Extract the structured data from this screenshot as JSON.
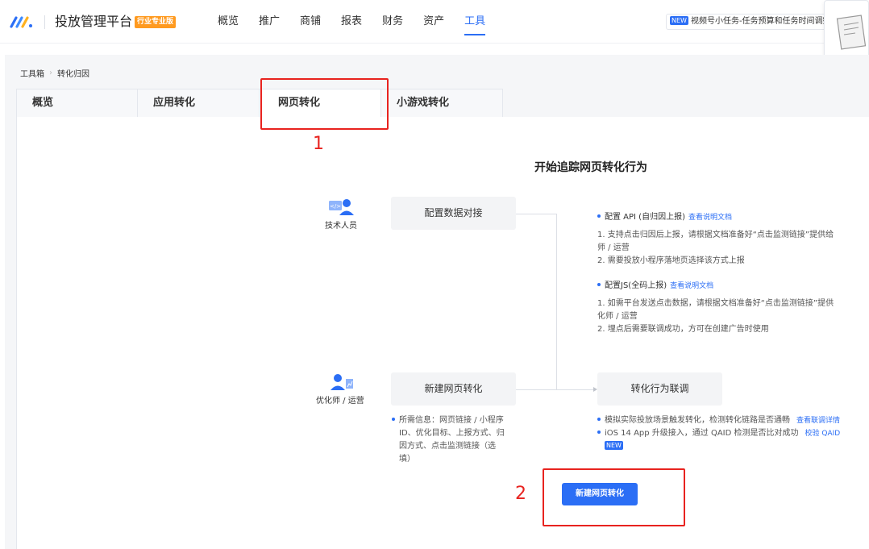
{
  "header": {
    "app_title": "投放管理平台",
    "edition_badge": "行业专业版",
    "nav": [
      "概览",
      "推广",
      "商铺",
      "报表",
      "财务",
      "资产",
      "工具"
    ],
    "active_nav": "工具",
    "notice_badge": "NEW",
    "notice_text": "视频号小任务-任务预算和任务时间调整"
  },
  "breadcrumb": [
    "工具箱",
    "转化归因"
  ],
  "tabs": [
    "概览",
    "应用转化",
    "网页转化",
    "小游戏转化"
  ],
  "active_tab": "网页转化",
  "main": {
    "title": "开始追踪网页转化行为",
    "roles": {
      "tech": "技术人员",
      "optimizer": "优化师 / 运营"
    },
    "steps": {
      "config": "配置数据对接",
      "create": "新建网页转化",
      "debug": "转化行为联调"
    },
    "api": {
      "title": "配置 API (自归因上报)",
      "link": "查看说明文档",
      "line1": "1. 支持点击归因后上报，请根据文档准备好“点击监测链接”提供给",
      "line1b": "师 / 运营",
      "line2": "2. 需要投放小程序落地页选择该方式上报"
    },
    "js": {
      "title": "配置JS(全码上报)",
      "link": "查看说明文档",
      "line1": "1. 如需平台发送点击数据，请根据文档准备好“点击监测链接”提供",
      "line1b": "化师 / 运营",
      "line2": "2. 埋点后需要联调成功，方可在创建广告时使用"
    },
    "create_info": [
      "所需信息：网页链接 / 小程序",
      "ID、优化目标、上报方式、归",
      "因方式、点击监测链接（选",
      "填）"
    ],
    "debug_info": {
      "line1": "模拟实际投放场景触发转化，检测转化链路是否通畅",
      "line1_link": "查看联调详情",
      "line2": "iOS 14 App 升级接入，通过 QAID 检测是否比对成功",
      "line2_link": "校验 QAID",
      "new_badge": "NEW"
    },
    "create_button": "新建网页转化"
  },
  "annotations": [
    "1",
    "2"
  ]
}
